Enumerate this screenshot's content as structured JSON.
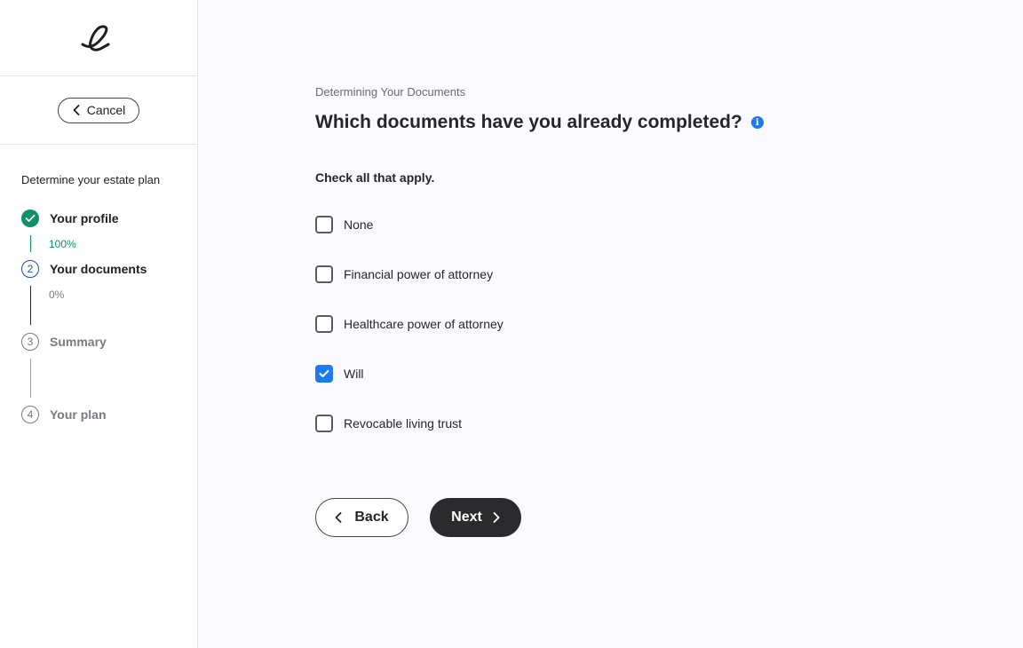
{
  "sidebar": {
    "logo_glyph": "e",
    "cancel_label": "Cancel",
    "plan_title": "Determine your estate plan",
    "steps": [
      {
        "number": "",
        "label": "Your profile",
        "progress": "100%",
        "status": "complete"
      },
      {
        "number": "2",
        "label": "Your documents",
        "progress": "0%",
        "status": "current"
      },
      {
        "number": "3",
        "label": "Summary",
        "status": "upcoming"
      },
      {
        "number": "4",
        "label": "Your plan",
        "status": "upcoming"
      }
    ]
  },
  "main": {
    "eyebrow": "Determining Your Documents",
    "question": "Which documents have you already completed?",
    "hint": "Check all that apply.",
    "options": [
      {
        "label": "None",
        "checked": false
      },
      {
        "label": "Financial power of attorney",
        "checked": false
      },
      {
        "label": "Healthcare power of attorney",
        "checked": false
      },
      {
        "label": "Will",
        "checked": true
      },
      {
        "label": "Revocable living trust",
        "checked": false
      }
    ],
    "back_label": "Back",
    "next_label": "Next"
  },
  "colors": {
    "accent": "#1d7af0",
    "complete": "#0f8f6a",
    "current": "#1d4fa8",
    "muted": "#7a7a80",
    "dark_button": "#2b2b2e"
  },
  "icons": {
    "info": "info-icon",
    "check": "check-icon",
    "back": "chevron-left-icon",
    "next": "chevron-right-icon"
  }
}
